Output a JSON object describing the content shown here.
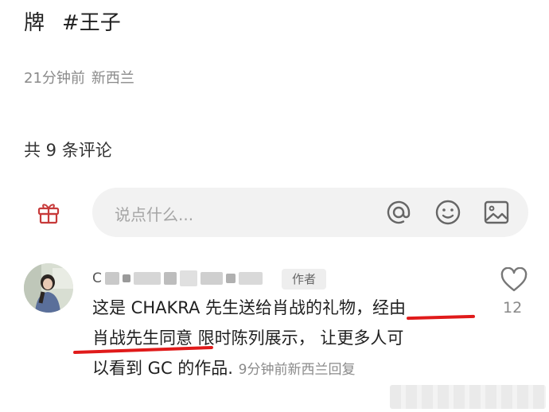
{
  "post": {
    "title_char": "牌",
    "title_tag": "#王子",
    "time_ago": "21分钟前",
    "location": "新西兰"
  },
  "comments_header": {
    "count_label": "共 9 条评论"
  },
  "comment_input": {
    "placeholder": "说点什么...",
    "icons": [
      "gift-icon",
      "at-icon",
      "emoji-icon",
      "image-icon"
    ]
  },
  "comment": {
    "author_visible": "C",
    "author_tag": "作者",
    "like_count": "12",
    "text_lines": [
      "这是 CHAKRA 先生送给肖战的礼物，经由",
      "肖战先生同意 限时陈列展示， 让更多人可",
      "以看到 GC 的作品."
    ],
    "time_ago": "9分钟前",
    "location": "新西兰",
    "reply_label": "回复"
  },
  "colors": {
    "underline": "#e01a1a",
    "muted_text": "#8a8a8a",
    "input_bg": "#f2f2f2",
    "gift_icon": "#c73a3a"
  }
}
